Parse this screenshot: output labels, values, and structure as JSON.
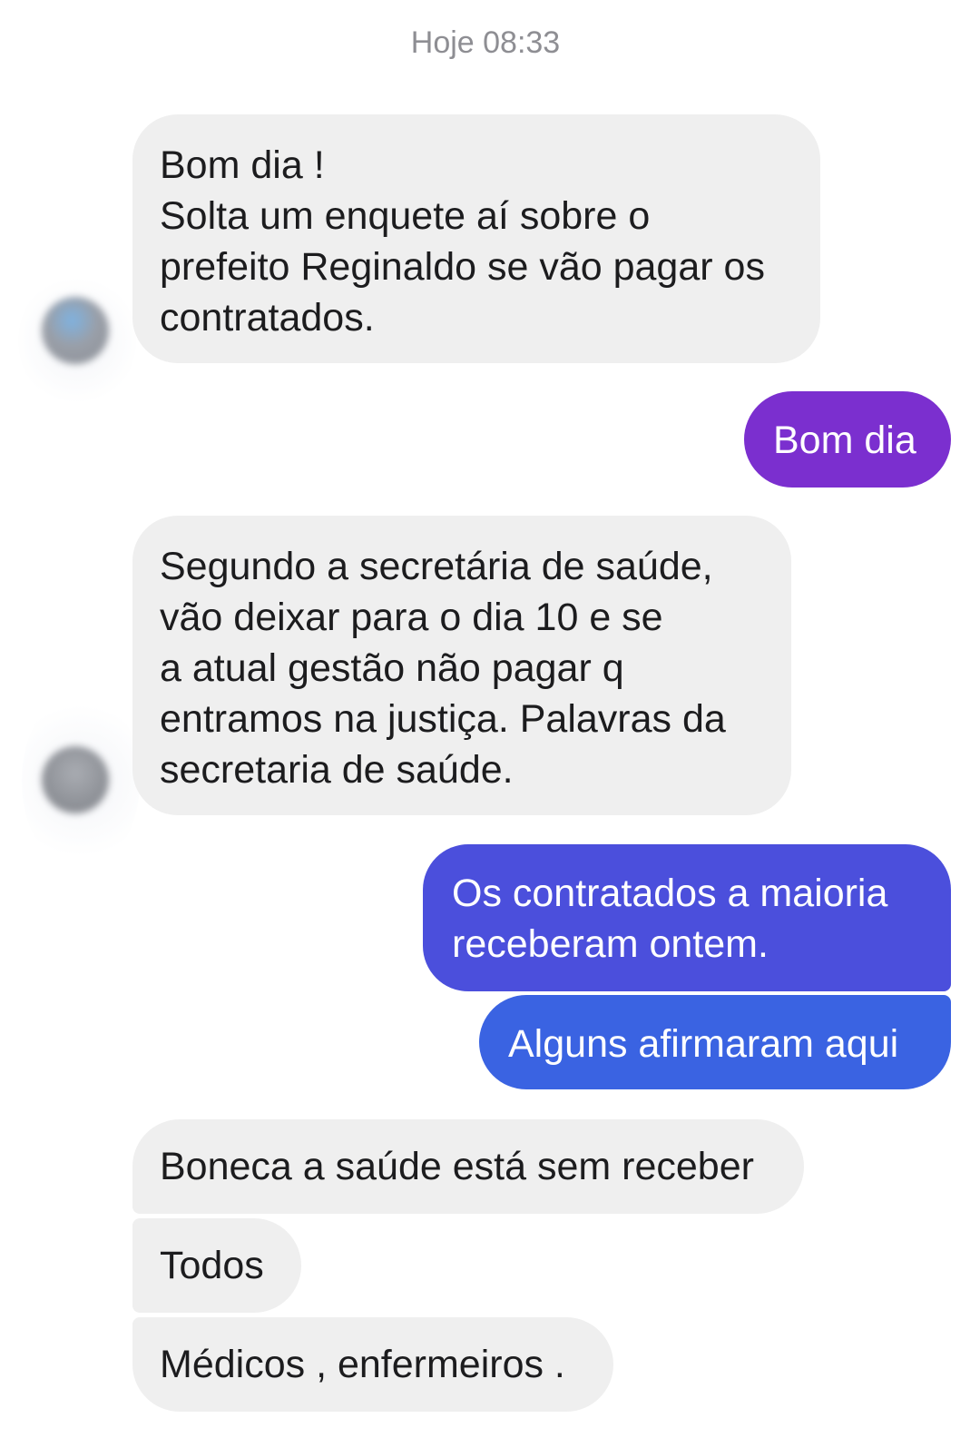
{
  "conversation": {
    "timestamp": "Hoje 08:33",
    "messages": [
      {
        "direction": "incoming",
        "text": "Bom dia !\nSolta um enquete aí sobre o\nprefeito Reginaldo se vão pagar os\ncontratados."
      },
      {
        "direction": "outgoing",
        "text": "Bom dia"
      },
      {
        "direction": "incoming",
        "text": "Segundo a secretária de saúde,\nvão deixar para o dia 10 e se\na atual gestão não pagar q\nentramos na justiça. Palavras da\nsecretaria de saúde."
      },
      {
        "direction": "outgoing",
        "text": "Os contratados a maioria\nreceberam ontem."
      },
      {
        "direction": "outgoing",
        "text": "Alguns afirmaram aqui"
      },
      {
        "direction": "incoming",
        "text": "Boneca a saúde está sem receber"
      },
      {
        "direction": "incoming",
        "text": "Todos"
      },
      {
        "direction": "incoming",
        "text": "Médicos , enfermeiros ."
      }
    ]
  },
  "colors": {
    "incoming_bubble": "#efefef",
    "outgoing_purple": "#7b2fcf",
    "outgoing_indigo": "#4b4fdc",
    "outgoing_blue": "#3a63e2",
    "timestamp_text": "#8e8e93"
  }
}
